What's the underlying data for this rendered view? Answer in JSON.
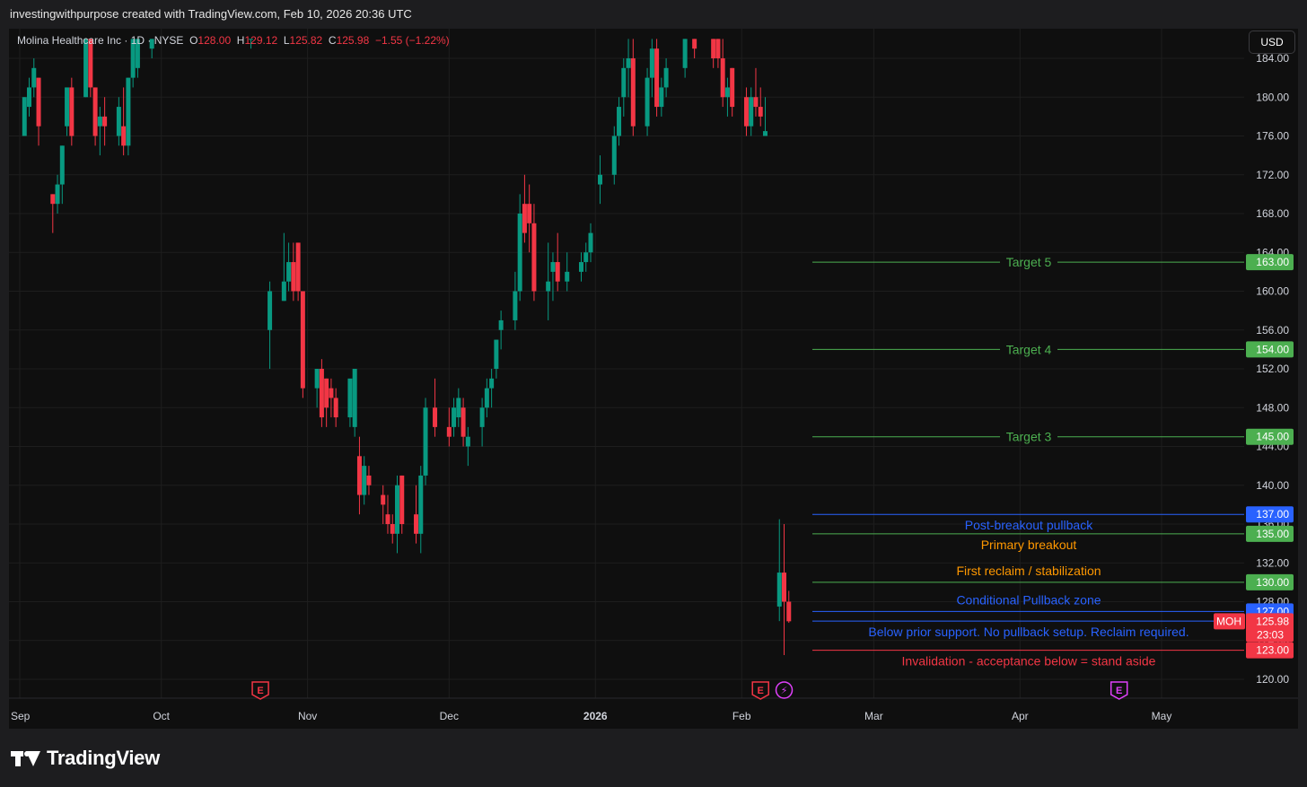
{
  "header": {
    "credit": "investingwithpurpose created with TradingView.com, Feb 10, 2026 20:36 UTC"
  },
  "legend": {
    "name": "Molina Healthcare Inc · 1D · NYSE",
    "o_label": "O",
    "o": "128.00",
    "h_label": "H",
    "h": "129.12",
    "l_label": "L",
    "l": "125.82",
    "c_label": "C",
    "c": "125.98",
    "change": "−1.55 (−1.22%)"
  },
  "currency_button": "USD",
  "footer": {
    "brand": "TradingView"
  },
  "colors": {
    "background": "#0f0f0f",
    "up": "#089981",
    "down": "#f23645",
    "grid": "#1e1e1e",
    "axis_text": "#d1d4dc",
    "target_green": "#4caf50",
    "zone_blue": "#2962ff",
    "breakout_orange": "#ff9800",
    "invalid_red": "#f23645"
  },
  "chart_data": {
    "type": "candlestick",
    "symbol": "MOH",
    "ylim": [
      117.5,
      186.0
    ],
    "y_ticks": [
      120,
      124,
      128,
      132,
      136,
      140,
      144,
      148,
      152,
      156,
      160,
      164,
      168,
      172,
      176,
      180,
      184
    ],
    "x_labels": [
      "Sep",
      "Oct",
      "Nov",
      "Dec",
      "2026",
      "Feb",
      "Mar",
      "Apr",
      "May"
    ],
    "x_label_dates": [
      "2025-09-01",
      "2025-10-01",
      "2025-11-01",
      "2025-12-01",
      "2026-01-01",
      "2026-02-01",
      "2026-03-01",
      "2026-04-01",
      "2026-05-01"
    ],
    "candles": [
      {
        "date": "2025-09-02",
        "o": 176,
        "h": 180,
        "l": 176,
        "c": 180
      },
      {
        "date": "2025-09-03",
        "o": 179,
        "h": 182,
        "l": 178,
        "c": 181
      },
      {
        "date": "2025-09-04",
        "o": 181,
        "h": 184,
        "l": 180,
        "c": 183
      },
      {
        "date": "2025-09-05",
        "o": 182,
        "h": 182,
        "l": 175,
        "c": 177
      },
      {
        "date": "2025-09-08",
        "o": 170,
        "h": 170,
        "l": 166,
        "c": 169
      },
      {
        "date": "2025-09-09",
        "o": 169,
        "h": 172,
        "l": 168,
        "c": 171
      },
      {
        "date": "2025-09-10",
        "o": 171,
        "h": 175,
        "l": 169,
        "c": 175
      },
      {
        "date": "2025-09-11",
        "o": 177,
        "h": 181,
        "l": 176,
        "c": 181
      },
      {
        "date": "2025-09-12",
        "o": 181,
        "h": 182,
        "l": 175,
        "c": 176
      },
      {
        "date": "2025-09-15",
        "o": 180,
        "h": 186,
        "l": 180,
        "c": 186
      },
      {
        "date": "2025-09-16",
        "o": 186,
        "h": 186,
        "l": 180,
        "c": 181
      },
      {
        "date": "2025-09-17",
        "o": 181,
        "h": 181,
        "l": 175,
        "c": 176
      },
      {
        "date": "2025-09-18",
        "o": 177,
        "h": 179,
        "l": 174,
        "c": 178
      },
      {
        "date": "2025-09-19",
        "o": 178,
        "h": 180,
        "l": 175,
        "c": 177
      },
      {
        "date": "2025-09-22",
        "o": 176,
        "h": 180,
        "l": 175,
        "c": 179
      },
      {
        "date": "2025-09-23",
        "o": 177,
        "h": 181,
        "l": 174,
        "c": 175
      },
      {
        "date": "2025-09-24",
        "o": 175,
        "h": 182,
        "l": 174,
        "c": 182
      },
      {
        "date": "2025-09-25",
        "o": 182,
        "h": 186,
        "l": 181,
        "c": 186
      },
      {
        "date": "2025-09-26",
        "o": 183,
        "h": 186,
        "l": 182,
        "c": 186
      },
      {
        "date": "2025-09-29",
        "o": 185,
        "h": 186,
        "l": 184,
        "c": 186
      },
      {
        "date": "2025-10-20",
        "o": 186,
        "h": 186,
        "l": 185,
        "c": 186
      },
      {
        "date": "2025-10-24",
        "o": 156,
        "h": 161,
        "l": 152,
        "c": 160
      },
      {
        "date": "2025-10-27",
        "o": 159,
        "h": 166,
        "l": 159,
        "c": 161
      },
      {
        "date": "2025-10-28",
        "o": 161,
        "h": 165,
        "l": 160,
        "c": 163
      },
      {
        "date": "2025-10-29",
        "o": 163,
        "h": 165,
        "l": 159,
        "c": 160
      },
      {
        "date": "2025-10-30",
        "o": 165,
        "h": 165,
        "l": 159,
        "c": 160
      },
      {
        "date": "2025-10-31",
        "o": 160,
        "h": 160,
        "l": 149,
        "c": 150
      },
      {
        "date": "2025-11-03",
        "o": 150,
        "h": 152,
        "l": 148,
        "c": 152
      },
      {
        "date": "2025-11-04",
        "o": 152,
        "h": 153,
        "l": 146,
        "c": 147
      },
      {
        "date": "2025-11-05",
        "o": 151,
        "h": 151,
        "l": 146,
        "c": 148
      },
      {
        "date": "2025-11-06",
        "o": 150,
        "h": 151,
        "l": 147,
        "c": 149
      },
      {
        "date": "2025-11-07",
        "o": 149,
        "h": 150,
        "l": 146,
        "c": 147
      },
      {
        "date": "2025-11-10",
        "o": 147,
        "h": 150,
        "l": 146,
        "c": 151
      },
      {
        "date": "2025-11-11",
        "o": 146,
        "h": 150,
        "l": 145,
        "c": 152
      },
      {
        "date": "2025-11-12",
        "o": 143,
        "h": 145,
        "l": 137,
        "c": 139
      },
      {
        "date": "2025-11-13",
        "o": 139,
        "h": 143,
        "l": 138,
        "c": 142
      },
      {
        "date": "2025-11-14",
        "o": 141,
        "h": 142,
        "l": 139,
        "c": 140
      },
      {
        "date": "2025-11-17",
        "o": 139,
        "h": 140,
        "l": 136,
        "c": 138
      },
      {
        "date": "2025-11-18",
        "o": 137,
        "h": 139,
        "l": 135,
        "c": 136
      },
      {
        "date": "2025-11-19",
        "o": 136,
        "h": 137,
        "l": 134,
        "c": 135
      },
      {
        "date": "2025-11-20",
        "o": 135,
        "h": 141,
        "l": 133,
        "c": 140
      },
      {
        "date": "2025-11-21",
        "o": 141,
        "h": 141,
        "l": 135,
        "c": 136
      },
      {
        "date": "2025-11-24",
        "o": 137,
        "h": 140,
        "l": 134,
        "c": 135
      },
      {
        "date": "2025-11-25",
        "o": 135,
        "h": 142,
        "l": 133,
        "c": 141
      },
      {
        "date": "2025-11-26",
        "o": 141,
        "h": 149,
        "l": 140,
        "c": 148
      },
      {
        "date": "2025-11-28",
        "o": 148,
        "h": 151,
        "l": 145,
        "c": 146
      },
      {
        "date": "2025-12-01",
        "o": 146,
        "h": 148,
        "l": 144,
        "c": 145
      },
      {
        "date": "2025-12-02",
        "o": 146,
        "h": 149,
        "l": 145,
        "c": 148
      },
      {
        "date": "2025-12-03",
        "o": 147,
        "h": 150,
        "l": 146,
        "c": 149
      },
      {
        "date": "2025-12-04",
        "o": 148,
        "h": 149,
        "l": 144,
        "c": 145
      },
      {
        "date": "2025-12-05",
        "o": 144,
        "h": 146,
        "l": 142,
        "c": 145
      },
      {
        "date": "2025-12-08",
        "o": 146,
        "h": 149,
        "l": 144,
        "c": 148
      },
      {
        "date": "2025-12-09",
        "o": 148,
        "h": 151,
        "l": 147,
        "c": 150
      },
      {
        "date": "2025-12-10",
        "o": 150,
        "h": 152,
        "l": 148,
        "c": 151
      },
      {
        "date": "2025-12-11",
        "o": 152,
        "h": 155,
        "l": 151,
        "c": 155
      },
      {
        "date": "2025-12-12",
        "o": 156,
        "h": 158,
        "l": 154,
        "c": 157
      },
      {
        "date": "2025-12-15",
        "o": 157,
        "h": 162,
        "l": 156,
        "c": 160
      },
      {
        "date": "2025-12-16",
        "o": 160,
        "h": 170,
        "l": 159,
        "c": 168
      },
      {
        "date": "2025-12-17",
        "o": 169,
        "h": 172,
        "l": 165,
        "c": 166
      },
      {
        "date": "2025-12-18",
        "o": 169,
        "h": 171,
        "l": 164,
        "c": 167
      },
      {
        "date": "2025-12-19",
        "o": 167,
        "h": 169,
        "l": 159,
        "c": 160
      },
      {
        "date": "2025-12-22",
        "o": 160,
        "h": 165,
        "l": 157,
        "c": 161
      },
      {
        "date": "2025-12-23",
        "o": 162,
        "h": 164,
        "l": 159,
        "c": 163
      },
      {
        "date": "2025-12-24",
        "o": 163,
        "h": 166,
        "l": 160,
        "c": 161
      },
      {
        "date": "2025-12-26",
        "o": 161,
        "h": 164,
        "l": 160,
        "c": 162
      },
      {
        "date": "2025-12-29",
        "o": 162,
        "h": 164,
        "l": 161,
        "c": 163
      },
      {
        "date": "2025-12-30",
        "o": 163,
        "h": 165,
        "l": 162,
        "c": 164
      },
      {
        "date": "2025-12-31",
        "o": 164,
        "h": 167,
        "l": 163,
        "c": 166
      },
      {
        "date": "2026-01-02",
        "o": 171,
        "h": 174,
        "l": 169,
        "c": 172
      },
      {
        "date": "2026-01-05",
        "o": 172,
        "h": 177,
        "l": 171,
        "c": 176
      },
      {
        "date": "2026-01-06",
        "o": 176,
        "h": 180,
        "l": 175,
        "c": 179
      },
      {
        "date": "2026-01-07",
        "o": 180,
        "h": 184,
        "l": 178,
        "c": 183
      },
      {
        "date": "2026-01-08",
        "o": 183,
        "h": 186,
        "l": 180,
        "c": 184
      },
      {
        "date": "2026-01-09",
        "o": 184,
        "h": 186,
        "l": 176,
        "c": 177
      },
      {
        "date": "2026-01-12",
        "o": 177,
        "h": 183,
        "l": 176,
        "c": 182
      },
      {
        "date": "2026-01-13",
        "o": 182,
        "h": 186,
        "l": 180,
        "c": 185
      },
      {
        "date": "2026-01-14",
        "o": 185,
        "h": 186,
        "l": 178,
        "c": 179
      },
      {
        "date": "2026-01-15",
        "o": 179,
        "h": 182,
        "l": 178,
        "c": 181
      },
      {
        "date": "2026-01-16",
        "o": 181,
        "h": 184,
        "l": 180,
        "c": 183
      },
      {
        "date": "2026-01-20",
        "o": 183,
        "h": 186,
        "l": 182,
        "c": 186
      },
      {
        "date": "2026-01-22",
        "o": 186,
        "h": 186,
        "l": 184,
        "c": 185
      },
      {
        "date": "2026-01-26",
        "o": 186,
        "h": 186,
        "l": 183,
        "c": 184
      },
      {
        "date": "2026-01-27",
        "o": 186,
        "h": 186,
        "l": 183,
        "c": 184
      },
      {
        "date": "2026-01-28",
        "o": 184,
        "h": 186,
        "l": 179,
        "c": 180
      },
      {
        "date": "2026-01-29",
        "o": 180,
        "h": 182,
        "l": 178,
        "c": 181
      },
      {
        "date": "2026-01-30",
        "o": 183,
        "h": 183,
        "l": 178,
        "c": 179
      },
      {
        "date": "2026-02-02",
        "o": 180,
        "h": 181,
        "l": 176,
        "c": 177
      },
      {
        "date": "2026-02-03",
        "o": 177,
        "h": 181,
        "l": 176,
        "c": 180
      },
      {
        "date": "2026-02-04",
        "o": 180,
        "h": 183,
        "l": 178,
        "c": 179
      },
      {
        "date": "2026-02-05",
        "o": 179,
        "h": 181,
        "l": 177,
        "c": 178
      },
      {
        "date": "2026-02-06",
        "o": 176,
        "h": 180,
        "l": 176,
        "c": 176.5
      },
      {
        "date": "2026-02-09",
        "o": 127.5,
        "h": 136.5,
        "l": 126,
        "c": 131
      },
      {
        "date": "2026-02-10",
        "o": 131,
        "h": 136,
        "l": 122.5,
        "c": 128
      },
      {
        "date": "2026-02-11",
        "o": 128,
        "h": 129.12,
        "l": 125.82,
        "c": 125.98
      }
    ],
    "levels": [
      {
        "name": "Target 5",
        "price": 163.0,
        "price_label": "163.00",
        "color": "#4caf50",
        "text": "Target 5",
        "text_style": "inline"
      },
      {
        "name": "Target 4",
        "price": 154.0,
        "price_label": "154.00",
        "color": "#4caf50",
        "text": "Target 4",
        "text_style": "inline"
      },
      {
        "name": "Target 3",
        "price": 145.0,
        "price_label": "145.00",
        "color": "#4caf50",
        "text": "Target 3",
        "text_style": "inline"
      },
      {
        "name": "Post-breakout pullback",
        "price": 137.0,
        "price_label": "137.00",
        "color": "#2962ff",
        "text": "Post-breakout pullback",
        "text_style": "below"
      },
      {
        "name": "Primary breakout",
        "price": 135.0,
        "price_label": "135.00",
        "color": "#4caf50",
        "text": "Primary breakout",
        "text_color": "#ff9800",
        "text_style": "below"
      },
      {
        "name": "First reclaim",
        "price": 130.0,
        "price_label": "130.00",
        "color": "#4caf50",
        "text": "First reclaim / stabilization",
        "text_color": "#ff9800",
        "text_style": "above_offset"
      },
      {
        "name": "Conditional pullback",
        "price": 127.0,
        "price_label": "127.00",
        "color": "#2962ff",
        "text": "Conditional Pullback zone",
        "text_style": "above_offset"
      },
      {
        "name": "Prior support",
        "price": 126.0,
        "price_label": "126.00",
        "color": "#2962ff",
        "text": "Below prior support. No pullback setup. Reclaim required.",
        "text_style": "below"
      },
      {
        "name": "Invalidation",
        "price": 123.0,
        "price_label": "123.00",
        "color": "#f23645",
        "text": "Invalidation - acceptance below = stand aside",
        "text_style": "below"
      }
    ],
    "last_price": {
      "symbol": "MOH",
      "price": 125.98,
      "price_label": "125.98",
      "countdown": "23:03",
      "color": "#f23645"
    },
    "events": [
      {
        "date": "2025-10-22",
        "glyph": "E",
        "color": "#f23645"
      },
      {
        "date": "2026-02-05",
        "glyph": "E",
        "color": "#f23645"
      },
      {
        "date": "2026-02-10",
        "glyph": "⚡",
        "color": "#e040fb"
      },
      {
        "date": "2026-04-22",
        "glyph": "E",
        "color": "#e040fb"
      }
    ]
  }
}
